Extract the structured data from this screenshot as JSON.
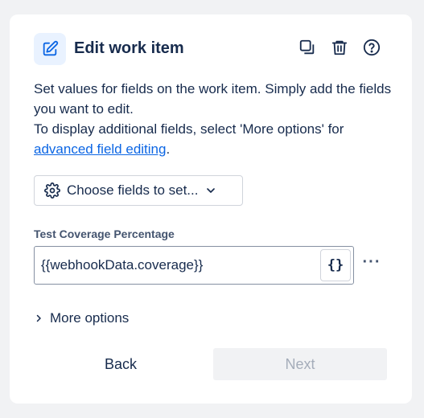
{
  "header": {
    "title": "Edit work item",
    "icons": [
      "edit-icon",
      "duplicate-icon",
      "delete-icon",
      "help-icon"
    ]
  },
  "description": {
    "line1": "Set values for fields on the work item. Simply add the fields you want to edit.",
    "line2_prefix": "To display additional fields, select 'More options' for ",
    "link": "advanced field editing",
    "line2_suffix": "."
  },
  "choose_fields": {
    "label": "Choose fields to set...",
    "icons": [
      "gear-icon",
      "chevron-down-icon"
    ]
  },
  "field": {
    "label": "Test Coverage Percentage",
    "value": "{{webhookData.coverage}}",
    "smart_value_button": "{}",
    "more_actions": "···"
  },
  "more_options": {
    "label": "More options"
  },
  "footer": {
    "back": "Back",
    "next": "Next"
  },
  "colors": {
    "accent": "#0c66e4",
    "header_icon_bg": "#e9f2ff",
    "disabled_bg": "#f1f2f4",
    "disabled_text": "#a5adba"
  }
}
